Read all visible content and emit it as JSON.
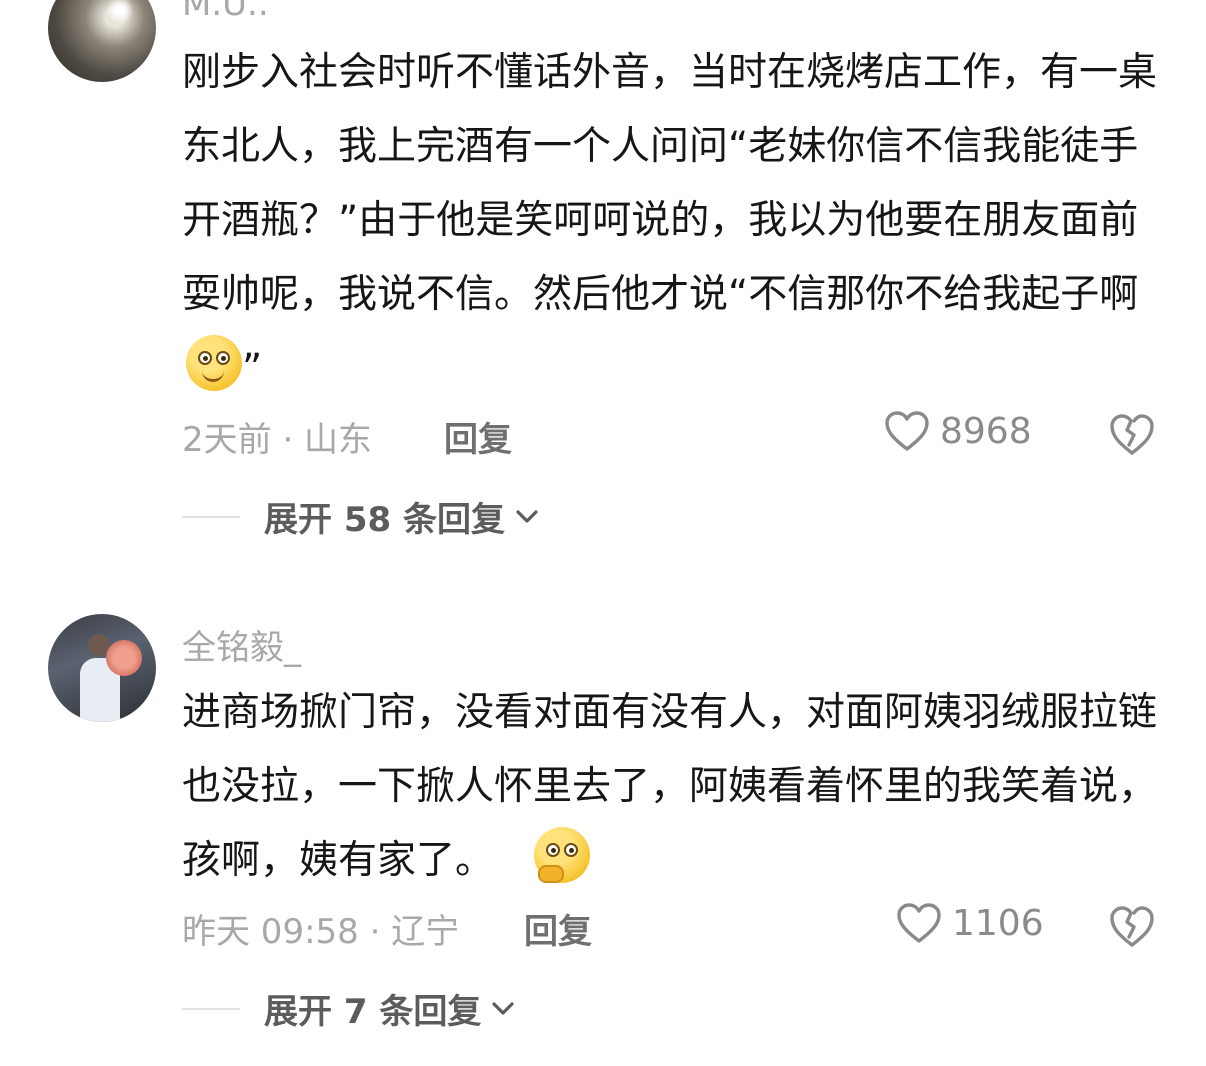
{
  "comments": [
    {
      "username": "M.U..",
      "text": "刚步入社会时听不懂话外音，当时在烧烤店工作，有一桌东北人，我上完酒有一个人问问“老妹你信不信我能徒手开酒瓶？”由于他是笑呵呵说的，我以为他要在朋友面前耍帅呢，我说不信。然后他才说“不信那你不给我起子啊",
      "text_tail": "”",
      "emoji": "dizzy-face-emoji",
      "meta": "2天前 · 山东",
      "reply_label": "回复",
      "likes": "8968",
      "expand_label": "展开 58 条回复"
    },
    {
      "username": "全铭毅_",
      "text": "进商场掀门帘，没看对面有没有人，对面阿姨羽绒服拉链也没拉，一下掀人怀里去了，阿姨看着怀里的我笑着说，孩啊，姨有家了。",
      "text_tail": "",
      "emoji": "thinking-face-emoji",
      "meta": "昨天 09:58 · 辽宁",
      "reply_label": "回复",
      "likes": "1106",
      "expand_label": "展开 7 条回复"
    }
  ],
  "colors": {
    "text": "#161616",
    "muted": "#a8a8a8",
    "icon": "#8a8a8a"
  }
}
